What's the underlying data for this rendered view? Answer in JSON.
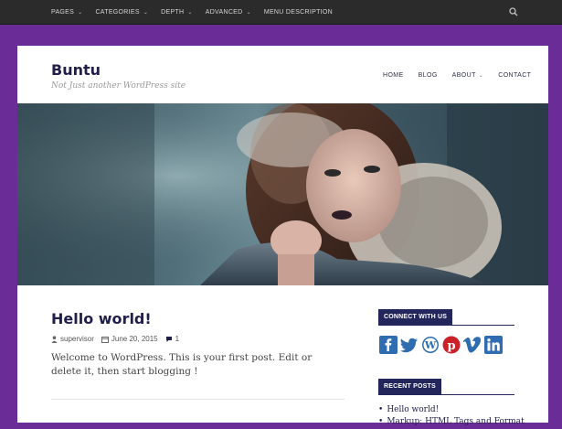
{
  "top_menu": {
    "items": [
      {
        "label": "PAGES",
        "has_dropdown": true
      },
      {
        "label": "CATEGORIES",
        "has_dropdown": true
      },
      {
        "label": "DEPTH",
        "has_dropdown": true
      },
      {
        "label": "ADVANCED",
        "has_dropdown": true
      },
      {
        "label": "MENU DESCRIPTION",
        "has_dropdown": false
      }
    ],
    "search_icon": "search-icon"
  },
  "site": {
    "title": "Buntu",
    "tagline": "Not Just another WordPress site"
  },
  "main_menu": {
    "items": [
      {
        "label": "HOME",
        "has_dropdown": false
      },
      {
        "label": "BLOG",
        "has_dropdown": false
      },
      {
        "label": "ABOUT",
        "has_dropdown": true
      },
      {
        "label": "CONTACT",
        "has_dropdown": false
      }
    ]
  },
  "hero": {
    "image_icon": "portrait-image"
  },
  "post": {
    "title": "Hello world!",
    "author": "supervisor",
    "date": "June 20, 2015",
    "comments": "1",
    "excerpt": "Welcome to WordPress. This is your first post. Edit or delete it, then start blogging !"
  },
  "sidebar": {
    "connect": {
      "title": "CONNECT WITH US",
      "networks": [
        "facebook-icon",
        "twitter-icon",
        "wordpress-icon",
        "pinterest-icon",
        "vimeo-icon",
        "linkedin-icon"
      ]
    },
    "recent_posts": {
      "title": "RECENT POSTS",
      "items": [
        "Hello world!",
        "Markup: HTML Tags and Format"
      ]
    }
  },
  "colors": {
    "background": "#6a2d98",
    "topbar": "#2b2b2b",
    "accent_dark": "#22265a",
    "text_dark": "#1f1f4a",
    "social_blue": "#2f6db0",
    "pinterest_red": "#cb2027"
  }
}
